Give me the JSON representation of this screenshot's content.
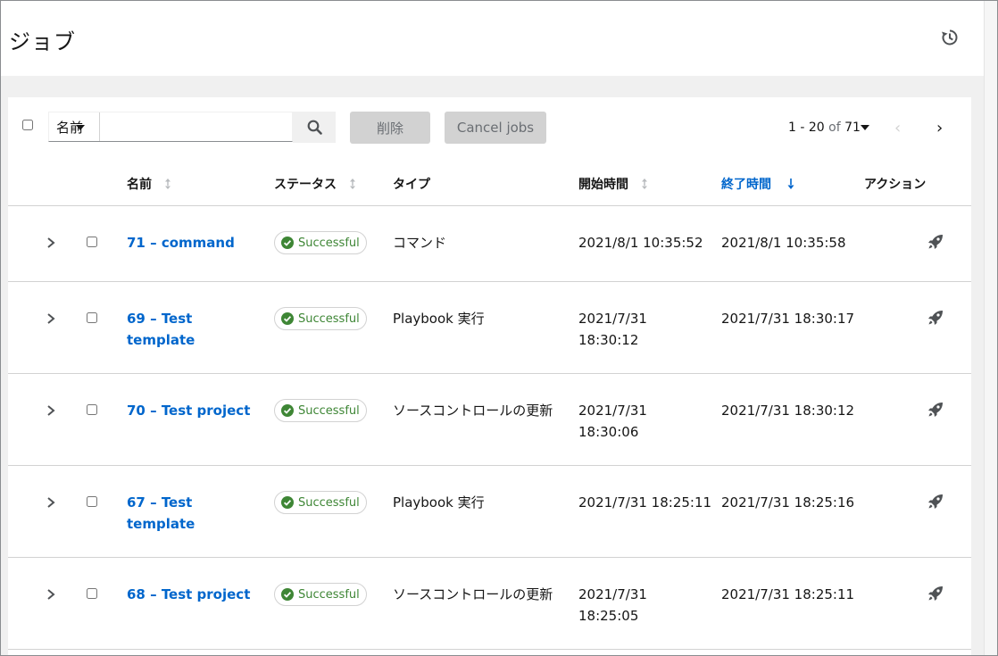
{
  "header": {
    "title": "ジョブ",
    "history_icon": "history-icon"
  },
  "toolbar": {
    "filter_field": "名前",
    "search_value": "",
    "delete_label": "削除",
    "cancel_label": "Cancel jobs",
    "pagination": {
      "range": "1 - 20",
      "of": "of",
      "total": "71"
    }
  },
  "table": {
    "headers": {
      "name": "名前",
      "status": "ステータス",
      "type": "タイプ",
      "started": "開始時間",
      "finished": "終了時間",
      "actions": "アクション"
    },
    "sorted_column": "finished",
    "accent_color": "#0066cc",
    "success_color": "#3e8635",
    "rows": [
      {
        "name": "71 – command",
        "status": "Successful",
        "type": "コマンド",
        "started": "2021/8/1 10:35:52",
        "finished": "2021/8/1 10:35:58"
      },
      {
        "name": "69 – Test template",
        "status": "Successful",
        "type": "Playbook 実行",
        "started": "2021/7/31 18:30:12",
        "finished": "2021/7/31 18:30:17"
      },
      {
        "name": "70 – Test project",
        "status": "Successful",
        "type": "ソースコントロールの更新",
        "started": "2021/7/31 18:30:06",
        "finished": "2021/7/31 18:30:12"
      },
      {
        "name": "67 – Test template",
        "status": "Successful",
        "type": "Playbook 実行",
        "started": "2021/7/31 18:25:11",
        "finished": "2021/7/31 18:25:16"
      },
      {
        "name": "68 – Test project",
        "status": "Successful",
        "type": "ソースコントロールの更新",
        "started": "2021/7/31 18:25:05",
        "finished": "2021/7/31 18:25:11"
      }
    ]
  }
}
